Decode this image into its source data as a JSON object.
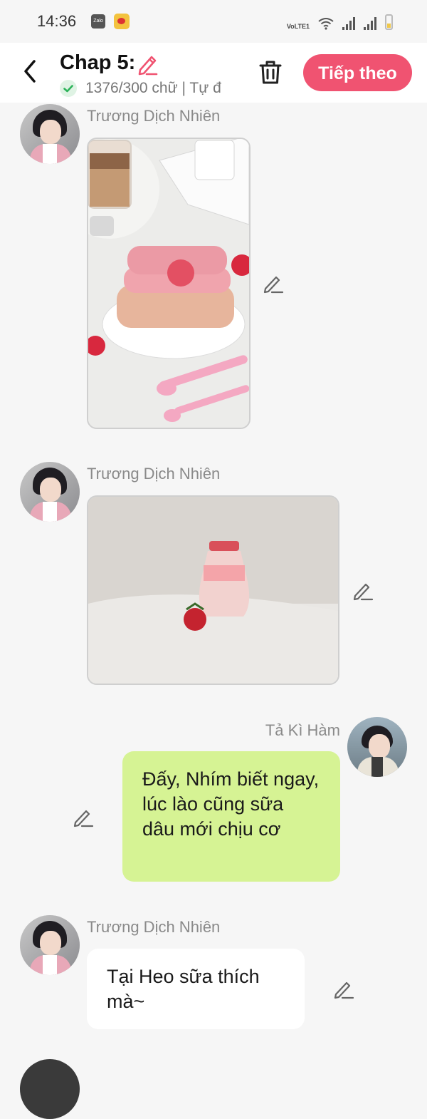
{
  "status_bar": {
    "time": "14:36",
    "zalo_label": "Zalo",
    "network_label": "VoLTE1"
  },
  "header": {
    "title": "Chap 5:",
    "progress": "1376/300 chữ | Tự đ",
    "next_button": "Tiếp theo",
    "accent_color": "#f05371"
  },
  "messages": [
    {
      "sender": "Trương Dịch Nhiên",
      "type": "image",
      "image_subject": "strawberry-dessert-photo",
      "side": "left"
    },
    {
      "sender": "Trương Dịch Nhiên",
      "type": "image",
      "image_subject": "strawberry-milk-bottle-photo",
      "side": "left"
    },
    {
      "sender": "Tả Kì Hàm",
      "type": "text",
      "text": "Đấy, Nhím biết ngay, lúc lào cũng sữa dâu mới chịu cơ",
      "side": "right"
    },
    {
      "sender": "Trương Dịch Nhiên",
      "type": "text",
      "text": "Tại Heo sữa thích mà~",
      "side": "left"
    }
  ],
  "colors": {
    "my_bubble": "#d6f394",
    "their_bubble": "#ffffff",
    "background": "#f6f6f6"
  }
}
